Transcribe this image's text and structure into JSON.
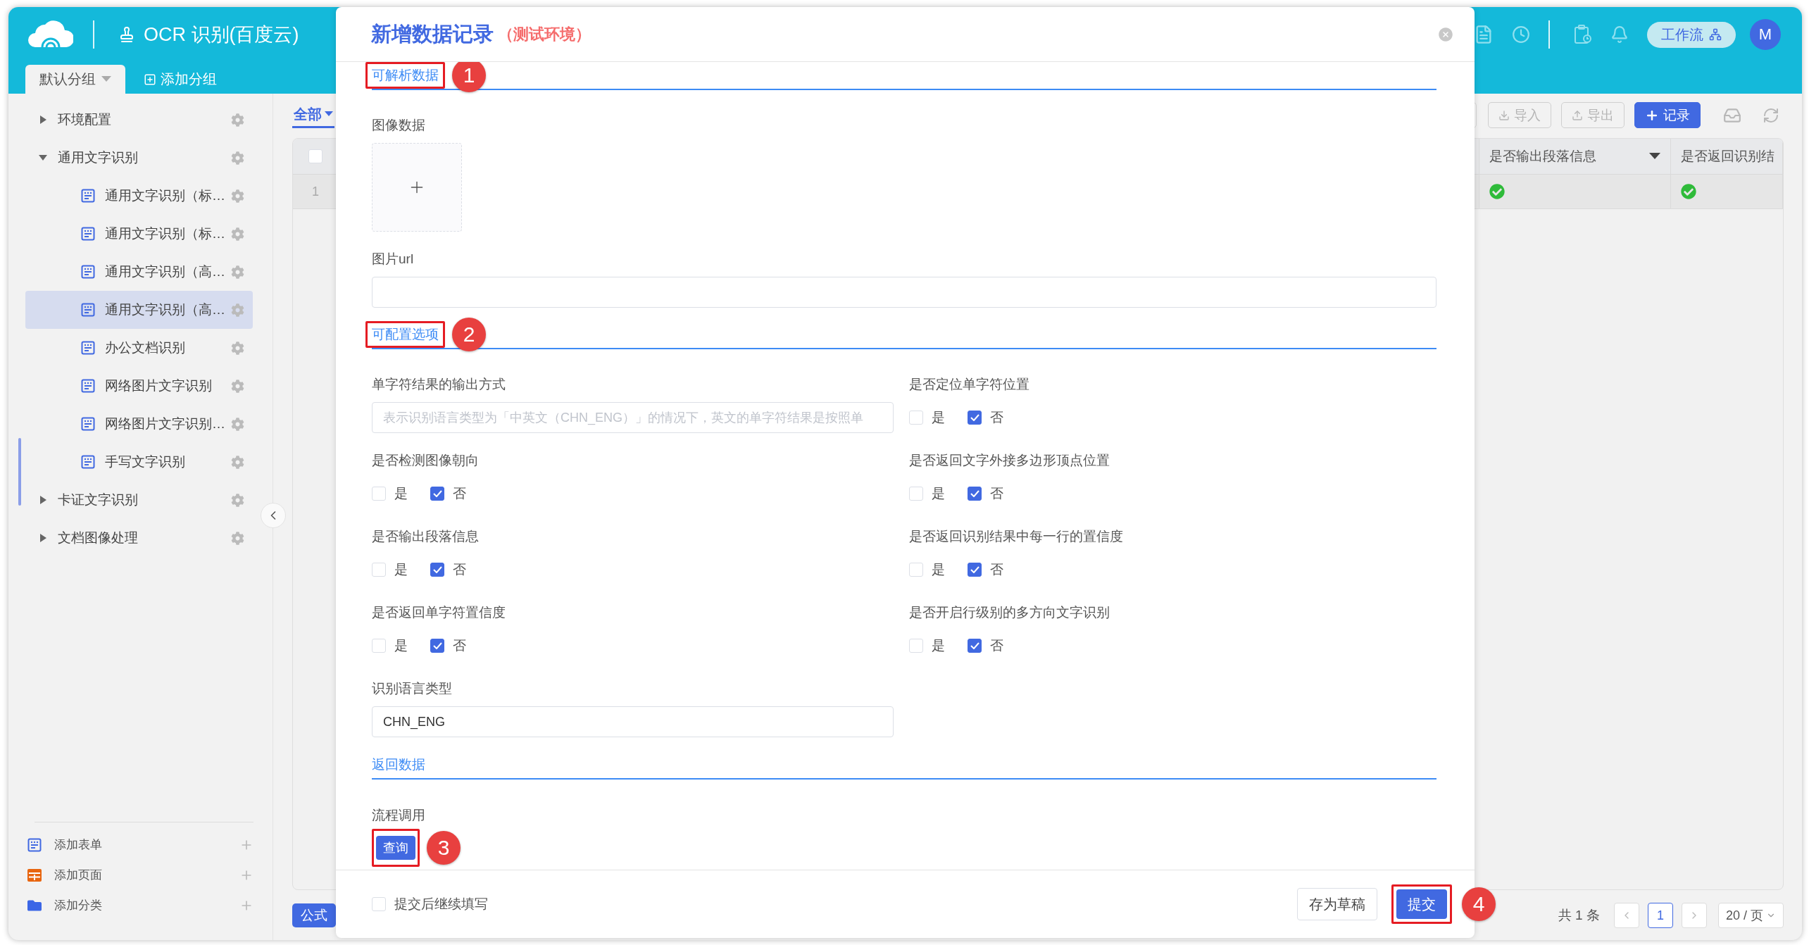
{
  "app": {
    "title": "OCR 识别(百度云)"
  },
  "group_tabs": [
    {
      "label": "默认分组",
      "selected": true
    }
  ],
  "add_group_button": "添加分组",
  "header_actions": {
    "workflow_button": "工作流",
    "avatar": "M"
  },
  "sidebar": {
    "items": [
      {
        "label": "环境配置",
        "expanded": false
      },
      {
        "label": "通用文字识别",
        "expanded": true,
        "children": [
          {
            "label": "通用文字识别（标…",
            "selected": false
          },
          {
            "label": "通用文字识别（标…",
            "selected": false
          },
          {
            "label": "通用文字识别（高…",
            "selected": false
          },
          {
            "label": "通用文字识别（高…",
            "selected": true
          },
          {
            "label": "办公文档识别",
            "selected": false
          },
          {
            "label": "网络图片文字识别",
            "selected": false
          },
          {
            "label": "网络图片文字识别…",
            "selected": false
          },
          {
            "label": "手写文字识别",
            "selected": false
          }
        ]
      },
      {
        "label": "卡证文字识别",
        "expanded": false
      },
      {
        "label": "文档图像处理",
        "expanded": false
      }
    ],
    "footer": [
      {
        "label": "添加表单",
        "kind": "form"
      },
      {
        "label": "添加页面",
        "kind": "page"
      },
      {
        "label": "添加分类",
        "kind": "folder"
      }
    ]
  },
  "main": {
    "filter_tab": {
      "label": "全部",
      "selected": true
    },
    "toolbar": [
      {
        "label": "导入",
        "kind": "import"
      },
      {
        "label": "导出",
        "kind": "export"
      },
      {
        "label": "记录",
        "kind": "add"
      }
    ],
    "table": {
      "select_all": {
        "checked": false
      },
      "columns": [
        {
          "label": "是否输出段落信息",
          "has_menu": true
        },
        {
          "label": "是否返回识别结",
          "has_menu": false
        }
      ],
      "rows": [
        {
          "index": "1",
          "cells": [
            {
              "checked": true
            },
            {
              "checked": true
            }
          ]
        }
      ]
    },
    "formula_button": "公式",
    "pagination": {
      "total": "共 1 条",
      "pages": [
        {
          "label": "1",
          "selected": true
        }
      ],
      "page_size": "20 / 页"
    }
  },
  "dialog": {
    "title": "新增数据记录",
    "environment": "（测试环境）",
    "sections": [
      {
        "title": "可解析数据",
        "callout": "1",
        "fields": [
          {
            "kind": "upload",
            "label": "图像数据"
          },
          {
            "kind": "text",
            "label": "图片url"
          }
        ]
      },
      {
        "title": "可配置选项",
        "callout": "2",
        "fields": [
          {
            "kind": "text",
            "label": "单字符结果的输出方式",
            "placeholder": "表示识别语言类型为「中英文（CHN_ENG）」的情况下，英文的单字符结果是按照单"
          },
          {
            "kind": "choice",
            "label": "是否定位单字符位置",
            "options": [
              {
                "label": "是",
                "checked": false
              },
              {
                "label": "否",
                "checked": true
              }
            ]
          },
          {
            "kind": "choice",
            "label": "是否检测图像朝向",
            "options": [
              {
                "label": "是",
                "checked": false
              },
              {
                "label": "否",
                "checked": true
              }
            ]
          },
          {
            "kind": "choice",
            "label": "是否返回文字外接多边形顶点位置",
            "options": [
              {
                "label": "是",
                "checked": false
              },
              {
                "label": "否",
                "checked": true
              }
            ]
          },
          {
            "kind": "choice",
            "label": "是否输出段落信息",
            "options": [
              {
                "label": "是",
                "checked": false
              },
              {
                "label": "否",
                "checked": true
              }
            ]
          },
          {
            "kind": "choice",
            "label": "是否返回识别结果中每一行的置信度",
            "options": [
              {
                "label": "是",
                "checked": false
              },
              {
                "label": "否",
                "checked": true
              }
            ]
          },
          {
            "kind": "choice",
            "label": "是否返回单字符置信度",
            "options": [
              {
                "label": "是",
                "checked": false
              },
              {
                "label": "否",
                "checked": true
              }
            ]
          },
          {
            "kind": "choice",
            "label": "是否开启行级别的多方向文字识别",
            "options": [
              {
                "label": "是",
                "checked": false
              },
              {
                "label": "否",
                "checked": true
              }
            ]
          },
          {
            "kind": "text",
            "label": "识别语言类型",
            "value": "CHN_ENG"
          }
        ]
      },
      {
        "title": "返回数据"
      }
    ],
    "workflow": {
      "label": "流程调用",
      "button": "查询",
      "callout": "3"
    },
    "footer": {
      "continue_checkbox": {
        "label": "提交后继续填写",
        "checked": false
      },
      "draft_button": "存为草稿",
      "submit_button": {
        "label": "提交",
        "callout": "4"
      }
    }
  }
}
